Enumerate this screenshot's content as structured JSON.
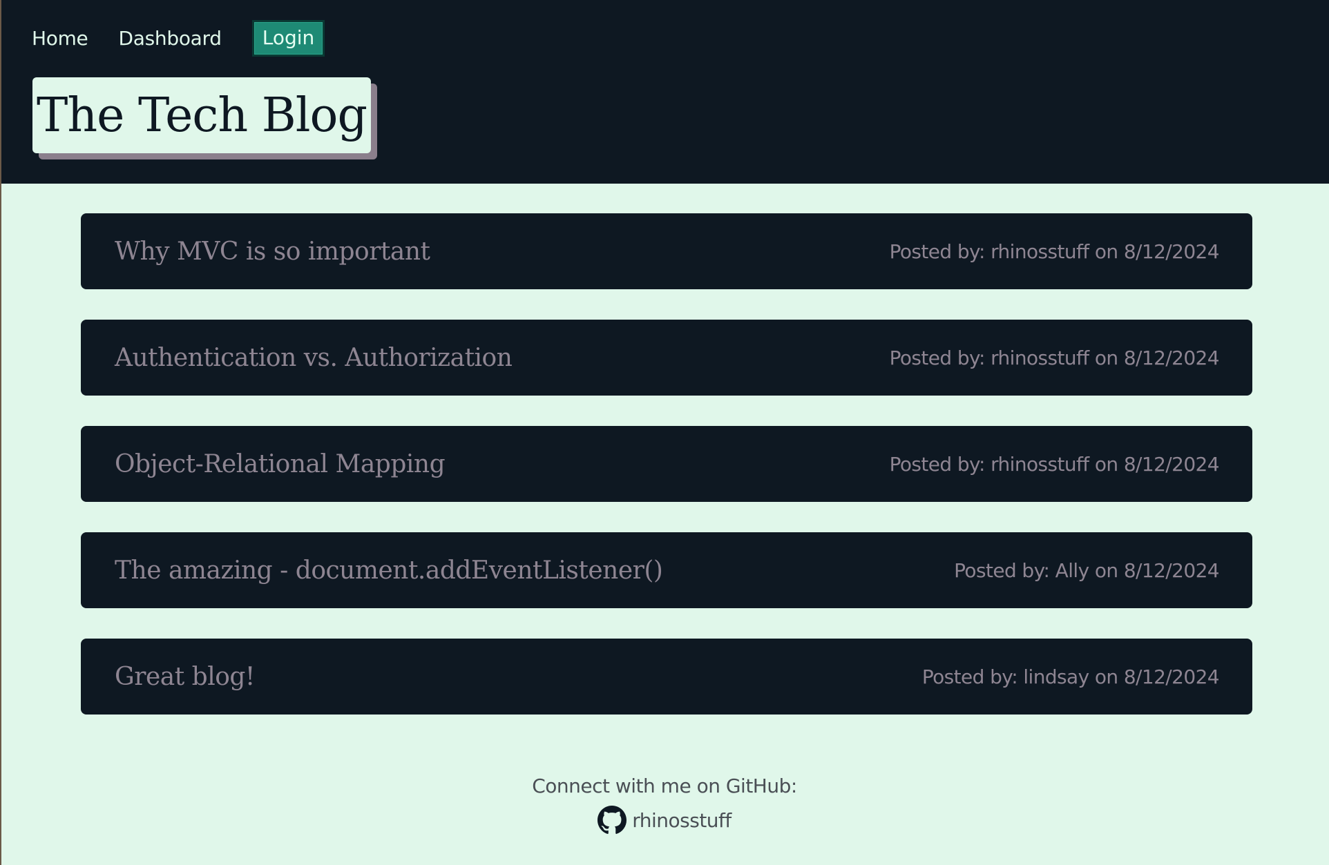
{
  "nav": {
    "home_label": "Home",
    "dashboard_label": "Dashboard",
    "login_label": "Login"
  },
  "site": {
    "title": "The Tech Blog"
  },
  "posts": [
    {
      "title": "Why MVC is so important",
      "meta": "Posted by: rhinosstuff on 8/12/2024"
    },
    {
      "title": "Authentication vs. Authorization",
      "meta": "Posted by: rhinosstuff on 8/12/2024"
    },
    {
      "title": "Object-Relational Mapping",
      "meta": "Posted by: rhinosstuff on 8/12/2024"
    },
    {
      "title": "The amazing - document.addEventListener()",
      "meta": "Posted by: Ally on 8/12/2024"
    },
    {
      "title": "Great blog!",
      "meta": "Posted by: lindsay on 8/12/2024"
    }
  ],
  "footer": {
    "connect_text": "Connect with me on GitHub:",
    "github_icon": "github-icon",
    "github_username": "rhinosstuff"
  },
  "colors": {
    "header_bg": "#0e1822",
    "page_bg": "#e0f7ea",
    "login_bg": "#1e8a75",
    "post_text": "#8e8592"
  }
}
